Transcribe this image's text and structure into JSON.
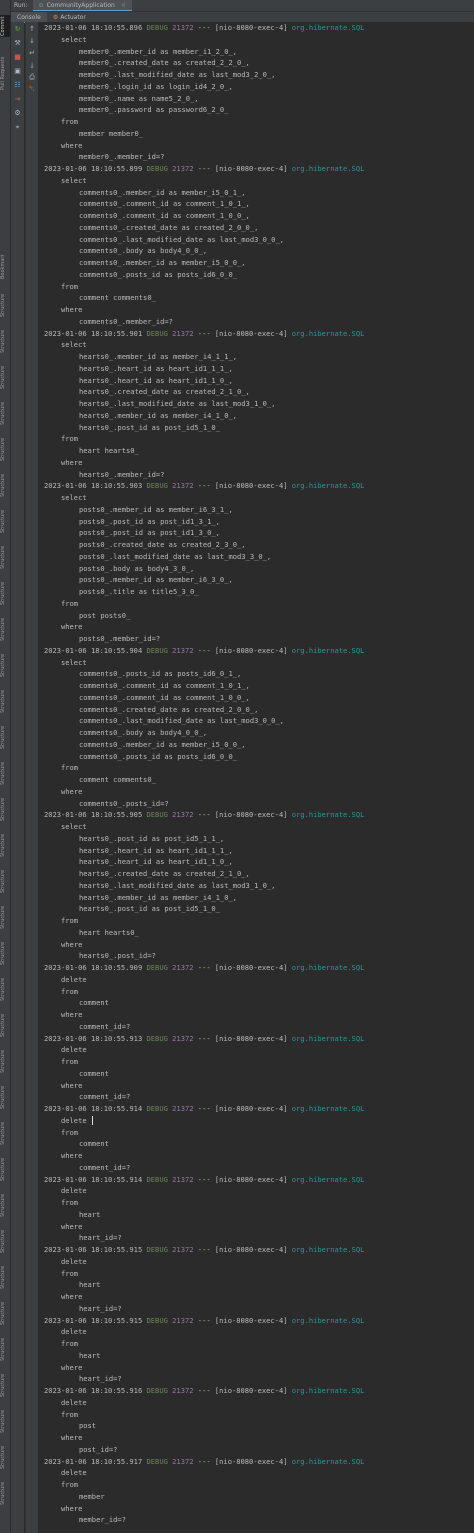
{
  "window": {
    "run_label": "Run:",
    "run_tab": "CommunityApplication",
    "console_tab": "Console",
    "actuator_tab": "Actuator"
  },
  "left_strip_labels": [
    "Commit",
    "Pull Requests",
    "Bookmarks",
    "Structure",
    "Structure",
    "Structure",
    "Structure",
    "Structure",
    "Structure",
    "Structure",
    "Structure",
    "Structure",
    "Structure",
    "Structure",
    "Structure",
    "Structure",
    "Structure",
    "Structure",
    "Structure",
    "Structure",
    "Structure",
    "Structure",
    "Structure",
    "Structure",
    "Structure",
    "Structure",
    "Structure",
    "Structure",
    "Structure",
    "Structure",
    "Structure",
    "Structure",
    "Structure",
    "Structure",
    "Structure",
    "Structure",
    "Structure"
  ],
  "toolbar_icons": [
    "rerun-icon",
    "wrench-icon",
    "stop-icon",
    "camera-icon",
    "restore-layout-icon",
    "exit-icon",
    "settings-icon",
    "pin-icon"
  ],
  "toolbar_icons_b": [
    "up-arrow-icon",
    "down-arrow-icon",
    "soft-wrap-icon",
    "scroll-to-end-icon",
    "print-icon",
    "trash-icon"
  ],
  "log_entries": [
    {
      "timestamp": "2023-01-06 18:10:55.896",
      "level": "DEBUG",
      "pid": "21372",
      "thread": "--- [nio-8080-exec-4]",
      "logger": "org.hibernate.SQL",
      "sql": [
        [
          1,
          "select"
        ],
        [
          2,
          "member0_.member_id as member_i1_2_0_,"
        ],
        [
          2,
          "member0_.created_date as created_2_2_0_,"
        ],
        [
          2,
          "member0_.last_modified_date as last_mod3_2_0_,"
        ],
        [
          2,
          "member0_.login_id as login_id4_2_0_,"
        ],
        [
          2,
          "member0_.name as name5_2_0_,"
        ],
        [
          2,
          "member0_.password as password6_2_0_"
        ],
        [
          1,
          "from"
        ],
        [
          2,
          "member member0_"
        ],
        [
          1,
          "where"
        ],
        [
          2,
          "member0_.member_id=?"
        ]
      ]
    },
    {
      "timestamp": "2023-01-06 18:10:55.899",
      "level": "DEBUG",
      "pid": "21372",
      "thread": "--- [nio-8080-exec-4]",
      "logger": "org.hibernate.SQL",
      "sql": [
        [
          1,
          "select"
        ],
        [
          2,
          "comments0_.member_id as member_i5_0_1_,"
        ],
        [
          2,
          "comments0_.comment_id as comment_1_0_1_,"
        ],
        [
          2,
          "comments0_.comment_id as comment_1_0_0_,"
        ],
        [
          2,
          "comments0_.created_date as created_2_0_0_,"
        ],
        [
          2,
          "comments0_.last_modified_date as last_mod3_0_0_,"
        ],
        [
          2,
          "comments0_.body as body4_0_0_,"
        ],
        [
          2,
          "comments0_.member_id as member_i5_0_0_,"
        ],
        [
          2,
          "comments0_.posts_id as posts_id6_0_0_"
        ],
        [
          1,
          "from"
        ],
        [
          2,
          "comment comments0_"
        ],
        [
          1,
          "where"
        ],
        [
          2,
          "comments0_.member_id=?"
        ]
      ]
    },
    {
      "timestamp": "2023-01-06 18:10:55.901",
      "level": "DEBUG",
      "pid": "21372",
      "thread": "--- [nio-8080-exec-4]",
      "logger": "org.hibernate.SQL",
      "sql": [
        [
          1,
          "select"
        ],
        [
          2,
          "hearts0_.member_id as member_i4_1_1_,"
        ],
        [
          2,
          "hearts0_.heart_id as heart_id1_1_1_,"
        ],
        [
          2,
          "hearts0_.heart_id as heart_id1_1_0_,"
        ],
        [
          2,
          "hearts0_.created_date as created_2_1_0_,"
        ],
        [
          2,
          "hearts0_.last_modified_date as last_mod3_1_0_,"
        ],
        [
          2,
          "hearts0_.member_id as member_i4_1_0_,"
        ],
        [
          2,
          "hearts0_.post_id as post_id5_1_0_"
        ],
        [
          1,
          "from"
        ],
        [
          2,
          "heart hearts0_"
        ],
        [
          1,
          "where"
        ],
        [
          2,
          "hearts0_.member_id=?"
        ]
      ]
    },
    {
      "timestamp": "2023-01-06 18:10:55.903",
      "level": "DEBUG",
      "pid": "21372",
      "thread": "--- [nio-8080-exec-4]",
      "logger": "org.hibernate.SQL",
      "sql": [
        [
          1,
          "select"
        ],
        [
          2,
          "posts0_.member_id as member_i6_3_1_,"
        ],
        [
          2,
          "posts0_.post_id as post_id1_3_1_,"
        ],
        [
          2,
          "posts0_.post_id as post_id1_3_0_,"
        ],
        [
          2,
          "posts0_.created_date as created_2_3_0_,"
        ],
        [
          2,
          "posts0_.last_modified_date as last_mod3_3_0_,"
        ],
        [
          2,
          "posts0_.body as body4_3_0_,"
        ],
        [
          2,
          "posts0_.member_id as member_i6_3_0_,"
        ],
        [
          2,
          "posts0_.title as title5_3_0_"
        ],
        [
          1,
          "from"
        ],
        [
          2,
          "post posts0_"
        ],
        [
          1,
          "where"
        ],
        [
          2,
          "posts0_.member_id=?"
        ]
      ]
    },
    {
      "timestamp": "2023-01-06 18:10:55.904",
      "level": "DEBUG",
      "pid": "21372",
      "thread": "--- [nio-8080-exec-4]",
      "logger": "org.hibernate.SQL",
      "sql": [
        [
          1,
          "select"
        ],
        [
          2,
          "comments0_.posts_id as posts_id6_0_1_,"
        ],
        [
          2,
          "comments0_.comment_id as comment_1_0_1_,"
        ],
        [
          2,
          "comments0_.comment_id as comment_1_0_0_,"
        ],
        [
          2,
          "comments0_.created_date as created_2_0_0_,"
        ],
        [
          2,
          "comments0_.last_modified_date as last_mod3_0_0_,"
        ],
        [
          2,
          "comments0_.body as body4_0_0_,"
        ],
        [
          2,
          "comments0_.member_id as member_i5_0_0_,"
        ],
        [
          2,
          "comments0_.posts_id as posts_id6_0_0_"
        ],
        [
          1,
          "from"
        ],
        [
          2,
          "comment comments0_"
        ],
        [
          1,
          "where"
        ],
        [
          2,
          "comments0_.posts_id=?"
        ]
      ]
    },
    {
      "timestamp": "2023-01-06 18:10:55.905",
      "level": "DEBUG",
      "pid": "21372",
      "thread": "--- [nio-8080-exec-4]",
      "logger": "org.hibernate.SQL",
      "sql": [
        [
          1,
          "select"
        ],
        [
          2,
          "hearts0_.post_id as post_id5_1_1_,"
        ],
        [
          2,
          "hearts0_.heart_id as heart_id1_1_1_,"
        ],
        [
          2,
          "hearts0_.heart_id as heart_id1_1_0_,"
        ],
        [
          2,
          "hearts0_.created_date as created_2_1_0_,"
        ],
        [
          2,
          "hearts0_.last_modified_date as last_mod3_1_0_,"
        ],
        [
          2,
          "hearts0_.member_id as member_i4_1_0_,"
        ],
        [
          2,
          "hearts0_.post_id as post_id5_1_0_"
        ],
        [
          1,
          "from"
        ],
        [
          2,
          "heart hearts0_"
        ],
        [
          1,
          "where"
        ],
        [
          2,
          "hearts0_.post_id=?"
        ]
      ]
    },
    {
      "timestamp": "2023-01-06 18:10:55.909",
      "level": "DEBUG",
      "pid": "21372",
      "thread": "--- [nio-8080-exec-4]",
      "logger": "org.hibernate.SQL",
      "sql": [
        [
          1,
          "delete"
        ],
        [
          1,
          "from"
        ],
        [
          2,
          "comment"
        ],
        [
          1,
          "where"
        ],
        [
          2,
          "comment_id=?"
        ]
      ]
    },
    {
      "timestamp": "2023-01-06 18:10:55.913",
      "level": "DEBUG",
      "pid": "21372",
      "thread": "--- [nio-8080-exec-4]",
      "logger": "org.hibernate.SQL",
      "sql": [
        [
          1,
          "delete"
        ],
        [
          1,
          "from"
        ],
        [
          2,
          "comment"
        ],
        [
          1,
          "where"
        ],
        [
          2,
          "comment_id=?"
        ]
      ]
    },
    {
      "timestamp": "2023-01-06 18:10:55.914",
      "level": "DEBUG",
      "pid": "21372",
      "thread": "--- [nio-8080-exec-4]",
      "logger": "org.hibernate.SQL",
      "caret_line": 0,
      "sql": [
        [
          1,
          "delete "
        ],
        [
          1,
          "from"
        ],
        [
          2,
          "comment"
        ],
        [
          1,
          "where"
        ],
        [
          2,
          "comment_id=?"
        ]
      ]
    },
    {
      "timestamp": "2023-01-06 18:10:55.914",
      "level": "DEBUG",
      "pid": "21372",
      "thread": "--- [nio-8080-exec-4]",
      "logger": "org.hibernate.SQL",
      "sql": [
        [
          1,
          "delete"
        ],
        [
          1,
          "from"
        ],
        [
          2,
          "heart"
        ],
        [
          1,
          "where"
        ],
        [
          2,
          "heart_id=?"
        ]
      ]
    },
    {
      "timestamp": "2023-01-06 18:10:55.915",
      "level": "DEBUG",
      "pid": "21372",
      "thread": "--- [nio-8080-exec-4]",
      "logger": "org.hibernate.SQL",
      "sql": [
        [
          1,
          "delete"
        ],
        [
          1,
          "from"
        ],
        [
          2,
          "heart"
        ],
        [
          1,
          "where"
        ],
        [
          2,
          "heart_id=?"
        ]
      ]
    },
    {
      "timestamp": "2023-01-06 18:10:55.915",
      "level": "DEBUG",
      "pid": "21372",
      "thread": "--- [nio-8080-exec-4]",
      "logger": "org.hibernate.SQL",
      "sql": [
        [
          1,
          "delete"
        ],
        [
          1,
          "from"
        ],
        [
          2,
          "heart"
        ],
        [
          1,
          "where"
        ],
        [
          2,
          "heart_id=?"
        ]
      ]
    },
    {
      "timestamp": "2023-01-06 18:10:55.916",
      "level": "DEBUG",
      "pid": "21372",
      "thread": "--- [nio-8080-exec-4]",
      "logger": "org.hibernate.SQL",
      "sql": [
        [
          1,
          "delete"
        ],
        [
          1,
          "from"
        ],
        [
          2,
          "post"
        ],
        [
          1,
          "where"
        ],
        [
          2,
          "post_id=?"
        ]
      ]
    },
    {
      "timestamp": "2023-01-06 18:10:55.917",
      "level": "DEBUG",
      "pid": "21372",
      "thread": "--- [nio-8080-exec-4]",
      "logger": "org.hibernate.SQL",
      "sql": [
        [
          1,
          "delete"
        ],
        [
          1,
          "from"
        ],
        [
          2,
          "member"
        ],
        [
          1,
          "where"
        ],
        [
          2,
          "member_id=?"
        ]
      ]
    }
  ],
  "colors": {
    "background": "#2b2b2b",
    "text": "#bbbbbb",
    "debug": "#6a8759",
    "pid": "#9876aa",
    "logger": "#299999",
    "panel": "#3c3f41"
  }
}
